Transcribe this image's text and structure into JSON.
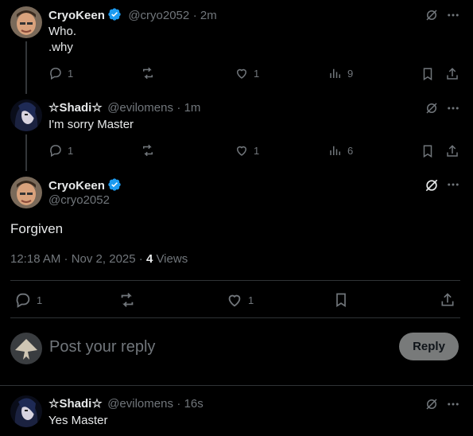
{
  "tweets": [
    {
      "author": "CryoKeen",
      "handle": "@cryo2052",
      "time": "· 2m",
      "lines": [
        "Who.",
        ".why"
      ],
      "replies": "1",
      "likes": "1",
      "views": "9"
    },
    {
      "author": "☆Shadi☆",
      "handle": "@evilomens",
      "time": "· 1m",
      "lines": [
        "I'm sorry Master"
      ],
      "replies": "1",
      "likes": "1",
      "views": "6"
    }
  ],
  "main_tweet": {
    "author": "CryoKeen",
    "handle": "@cryo2052",
    "text": "Forgiven",
    "timestamp": "12:18 AM · Nov 2, 2025 ·",
    "views_count": "4",
    "views_label": "Views",
    "replies": "1",
    "likes": "1"
  },
  "composer": {
    "placeholder": "Post your reply",
    "button_label": "Reply"
  },
  "reply_tweet": {
    "author": "☆Shadi☆",
    "handle": "@evilomens",
    "time": "· 16s",
    "text": "Yes Master"
  },
  "colors": {
    "verified": "#1d9bf0",
    "muted": "#71767b",
    "divider": "#2f3336"
  }
}
